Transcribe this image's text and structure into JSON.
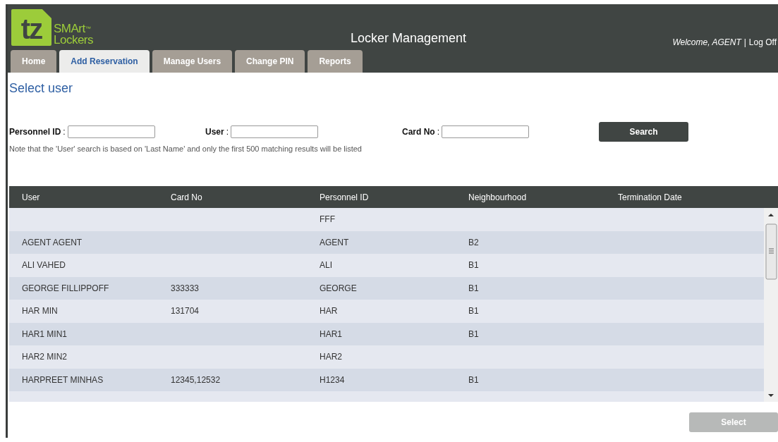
{
  "logo": {
    "mark": "tz",
    "line1": "SMArt",
    "tm": "™",
    "line2": "Lockers"
  },
  "header": {
    "title": "Locker Management",
    "welcome": "Welcome, AGENT",
    "separator": "|",
    "logoff": "Log Off"
  },
  "tabs": [
    {
      "label": "Home",
      "selected": false
    },
    {
      "label": "Add Reservation",
      "selected": true
    },
    {
      "label": "Manage Users",
      "selected": false
    },
    {
      "label": "Change PIN",
      "selected": false
    },
    {
      "label": "Reports",
      "selected": false
    }
  ],
  "page_title": "Select user",
  "search": {
    "fields": [
      {
        "label": "Personnel ID",
        "colon": ":"
      },
      {
        "label": "User",
        "colon": ":"
      },
      {
        "label": "Card No",
        "colon": ":"
      }
    ],
    "button": "Search",
    "note": "Note that the 'User' search is based on 'Last Name' and only the first 500 matching results will be listed"
  },
  "table": {
    "columns": [
      "User",
      "Card No",
      "Personnel ID",
      "Neighbourhood",
      "Termination Date"
    ],
    "rows": [
      [
        "",
        "",
        "FFF",
        "",
        ""
      ],
      [
        "AGENT AGENT",
        "",
        "AGENT",
        "B2",
        ""
      ],
      [
        "ALI VAHED",
        "",
        "ALI",
        "B1",
        ""
      ],
      [
        "GEORGE FILLIPPOFF",
        "333333",
        "GEORGE",
        "B1",
        ""
      ],
      [
        "HAR MIN",
        "131704",
        "HAR",
        "B1",
        ""
      ],
      [
        "HAR1 MIN1",
        "",
        "HAR1",
        "B1",
        ""
      ],
      [
        "HAR2 MIN2",
        "",
        "HAR2",
        "",
        ""
      ],
      [
        "HARPREET MINHAS",
        "12345,12532",
        "H1234",
        "B1",
        ""
      ]
    ]
  },
  "select_button": {
    "label": "Select",
    "disabled": true
  }
}
